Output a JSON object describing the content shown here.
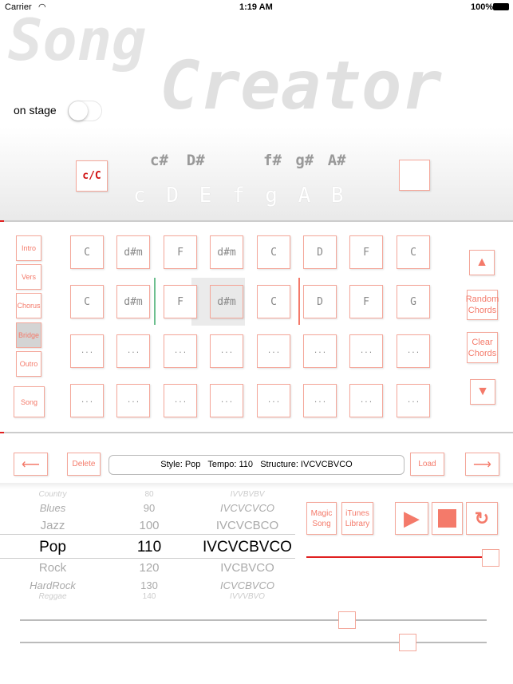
{
  "status": {
    "carrier": "Carrier",
    "time": "1:19 AM",
    "battery": "100%"
  },
  "app": {
    "logo_text": "Song Creator",
    "on_stage_label": "on stage",
    "on_stage": false
  },
  "keys": {
    "current_key": "c/C",
    "sharps": [
      "c#",
      "D#",
      "f#",
      "g#",
      "A#"
    ],
    "naturals": [
      "c",
      "D",
      "E",
      "f",
      "g",
      "A",
      "B"
    ]
  },
  "sections": [
    "Intro",
    "Vers",
    "Chorus",
    "Bridge",
    "Outro",
    "Song"
  ],
  "selected_section": "Bridge",
  "grid": [
    [
      "C",
      "d#m",
      "F",
      "d#m",
      "C",
      "D",
      "F",
      "C"
    ],
    [
      "C",
      "d#m",
      "F",
      "d#m",
      "C",
      "D",
      "F",
      "G"
    ],
    [
      "...",
      "...",
      "...",
      "...",
      "...",
      "...",
      "...",
      "..."
    ],
    [
      "...",
      "...",
      "...",
      "...",
      "...",
      "...",
      "...",
      "..."
    ]
  ],
  "side_buttons": {
    "random": "Random Chords",
    "clear": "Clear Chords"
  },
  "toolbar": {
    "delete": "Delete",
    "info": "Style: Pop   Tempo: 110   Structure: IVCVCBVCO",
    "load": "Load"
  },
  "picker": [
    {
      "style": "Country",
      "tempo": "80",
      "structure": "IVVBVBV"
    },
    {
      "style": "Blues",
      "tempo": "90",
      "structure": "IVCVCVCO"
    },
    {
      "style": "Jazz",
      "tempo": "100",
      "structure": "IVCVCBCO"
    },
    {
      "style": "Pop",
      "tempo": "110",
      "structure": "IVCVCBVCO"
    },
    {
      "style": "Rock",
      "tempo": "120",
      "structure": "IVCBVCO"
    },
    {
      "style": "HardRock",
      "tempo": "130",
      "structure": "ICVCBVCO"
    },
    {
      "style": "Reggae",
      "tempo": "140",
      "structure": "IVVVBVO"
    }
  ],
  "buttons": {
    "magic": "Magic Song",
    "itunes": "iTunes Library"
  },
  "colors": {
    "accent": "#f47a6a",
    "progress": "#e02020",
    "green_marker": "#6dbf8f"
  },
  "progress": 0.98,
  "sliders": [
    0.7,
    0.83
  ]
}
